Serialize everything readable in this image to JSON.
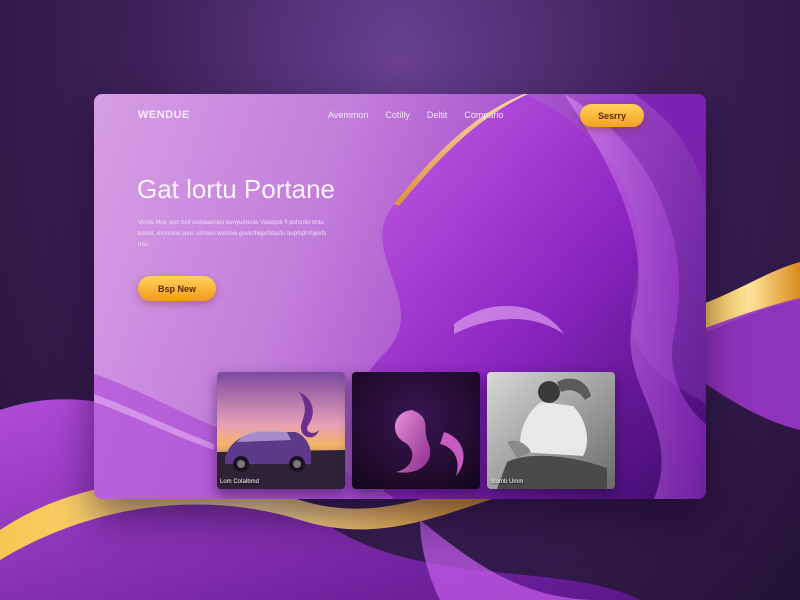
{
  "brand": {
    "logo": "WENDUE"
  },
  "nav": {
    "links": [
      "Avemmon",
      "Cotilly",
      "Deltit",
      "Compario"
    ],
    "cta_label": "Sesrry"
  },
  "hero": {
    "title": "Gat lortu Portane",
    "body": "Vinsis blue wun bsil vorkaaenlos bunyumenie Vavepsk fi pofuntio bhtu bsewr, eronnew senr. etoneis wesloie govicthepshitasfu bupfsphrhjexfs trav",
    "button_label": "Bsp New"
  },
  "gallery": [
    {
      "image": "purple-sports-car-at-sunset",
      "caption": "Lom Cotalbmd"
    },
    {
      "image": "purple-silk-swirl-on-dark",
      "caption": ""
    },
    {
      "image": "black-and-white-man-reclining",
      "caption": "Stomb Umm"
    }
  ],
  "colors": {
    "accent": "#f5a623",
    "brand_purple": "#8c2bbd",
    "background": "#3d2158"
  }
}
